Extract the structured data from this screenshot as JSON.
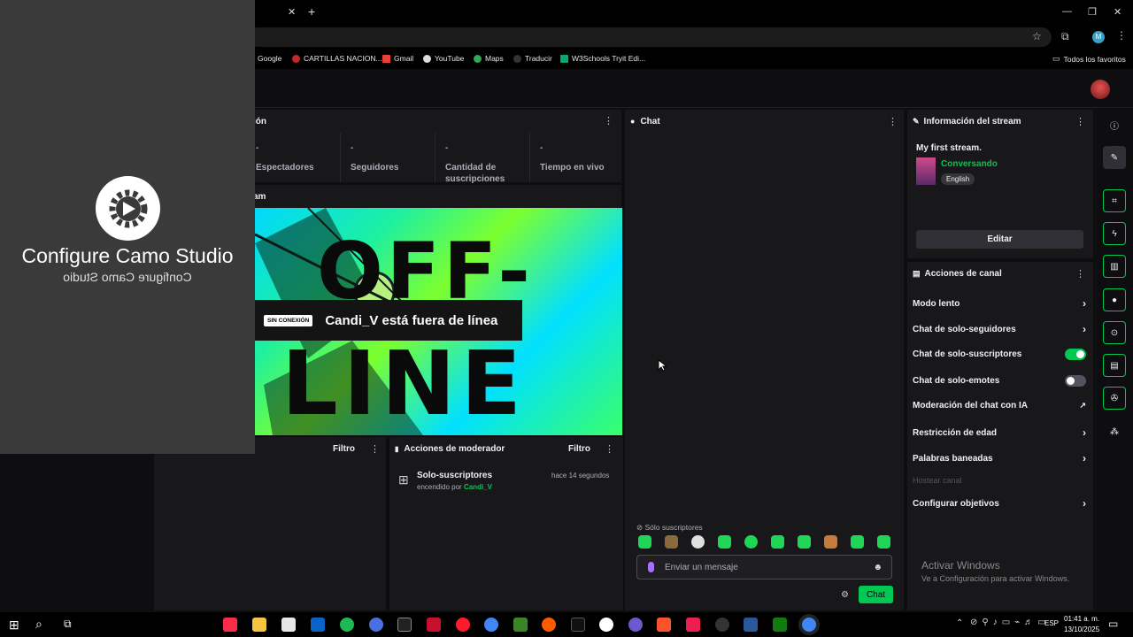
{
  "browser": {
    "bookmarks": [
      "Google",
      "CARTILLAS NACION...",
      "Gmail",
      "YouTube",
      "Maps",
      "Traducir",
      "W3Schools Tryit Edi..."
    ],
    "all_bookmarks": "Todos los favoritos",
    "profile_initial": "M"
  },
  "camo": {
    "title": "Configure Camo Studio",
    "mirror": "Configure Camo Studio"
  },
  "stats_panel": {
    "title_fragment": "ión",
    "stats": [
      {
        "value": "-",
        "label": "Espectadores"
      },
      {
        "value": "-",
        "label": "Seguidores"
      },
      {
        "value": "-",
        "label": "Cantidad de suscripciones"
      },
      {
        "value": "-",
        "label": "Tiempo en vivo"
      }
    ]
  },
  "preview": {
    "title_fragment": "am",
    "offline_badge": "SIN CONEXIÓN",
    "offline_text": "Candi_V está fuera de línea",
    "art_text_top": "OFF-",
    "art_text_bottom": "LINE"
  },
  "activity_panel": {
    "filter": "Filtro"
  },
  "mod_actions": {
    "title": "Acciones de moderador",
    "filter": "Filtro",
    "item_title": "Solo-suscriptores",
    "item_sub": "encendido por",
    "item_user": "Candi_V",
    "item_time": "hace 14 segundos"
  },
  "chat": {
    "title": "Chat",
    "subs_only": "Sólo suscriptores",
    "placeholder": "Enviar un mensaje",
    "send_label": "Chat"
  },
  "stream_info": {
    "title": "Información del stream",
    "stream_title": "My first stream.",
    "category": "Conversando",
    "tag": "English",
    "edit": "Editar"
  },
  "channel_actions": {
    "title": "Acciones de canal",
    "items": [
      {
        "label": "Modo lento",
        "control": "chevron"
      },
      {
        "label": "Chat de solo-seguidores",
        "control": "chevron"
      },
      {
        "label": "Chat de solo-suscriptores",
        "control": "toggle-on"
      },
      {
        "label": "Chat de solo-emotes",
        "control": "toggle-off"
      },
      {
        "label": "Moderación del chat con IA",
        "control": "external"
      },
      {
        "label": "Restricción de edad",
        "control": "chevron"
      },
      {
        "label": "Palabras baneadas",
        "control": "chevron"
      },
      {
        "label": "Hostear canal",
        "control": "disabled"
      },
      {
        "label": "Configurar objetivos",
        "control": "chevron"
      }
    ]
  },
  "windows_watermark": {
    "title": "Activar Windows",
    "subtitle": "Ve a Configuración para activar Windows."
  },
  "taskbar": {
    "lang": "ESP",
    "time": "01:41 a. m.",
    "date": "13/10/2025"
  },
  "colors": {
    "twitch_green": "#00c853",
    "panel": "#18181b",
    "background": "#0e0e10",
    "camo_panel": "#3a3a3a"
  }
}
